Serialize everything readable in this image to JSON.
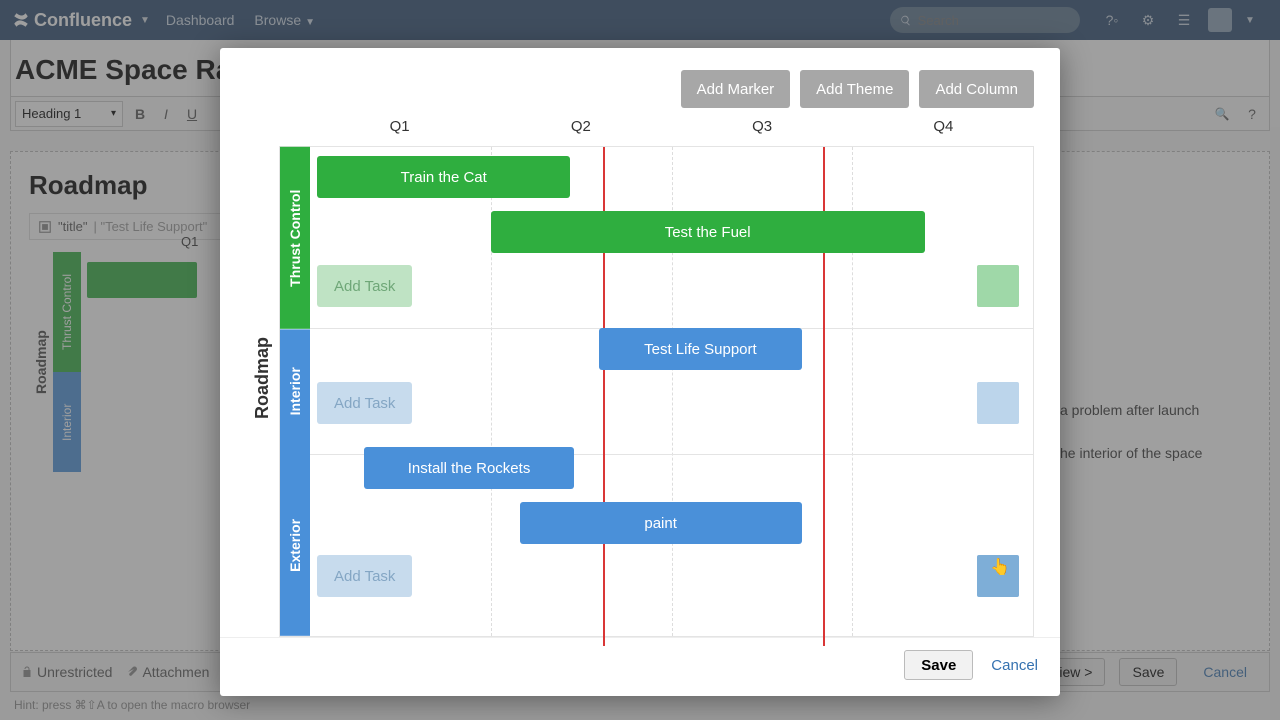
{
  "nav": {
    "brand": "Confluence",
    "dashboard": "Dashboard",
    "browse": "Browse",
    "search_placeholder": "Search"
  },
  "page": {
    "title_visible": "ACME Space Rac",
    "heading_select": "Heading 1",
    "content_heading": "Roadmap",
    "macro_text_a": "\"title\"",
    "macro_text_b": " | \"Test Life Support\"",
    "mini_q": "Q1",
    "mini_lane1": "Thrust Control",
    "mini_lane2": "Interior",
    "side_text1": "a problem after launch",
    "side_text2": "he interior of the space"
  },
  "bottom": {
    "unrestricted": "Unrestricted",
    "attachments": "Attachmen",
    "preview": "iew >",
    "save": "Save",
    "cancel": "Cancel",
    "hint": "Hint: press ⌘⇧A to open the macro browser"
  },
  "modal": {
    "add_marker": "Add Marker",
    "add_theme": "Add Theme",
    "add_column": "Add Column",
    "columns": [
      "Q1",
      "Q2",
      "Q3",
      "Q4"
    ],
    "lanes": {
      "roadmap": "Roadmap",
      "thrust": "Thrust Control",
      "interior": "Interior",
      "exterior": "Exterior"
    },
    "bars": {
      "train_cat": "Train the Cat",
      "test_fuel": "Test the Fuel",
      "test_life": "Test Life Support",
      "install_rockets": "Install the Rockets",
      "paint": "paint"
    },
    "add_task": "Add Task",
    "save": "Save",
    "cancel": "Cancel"
  }
}
